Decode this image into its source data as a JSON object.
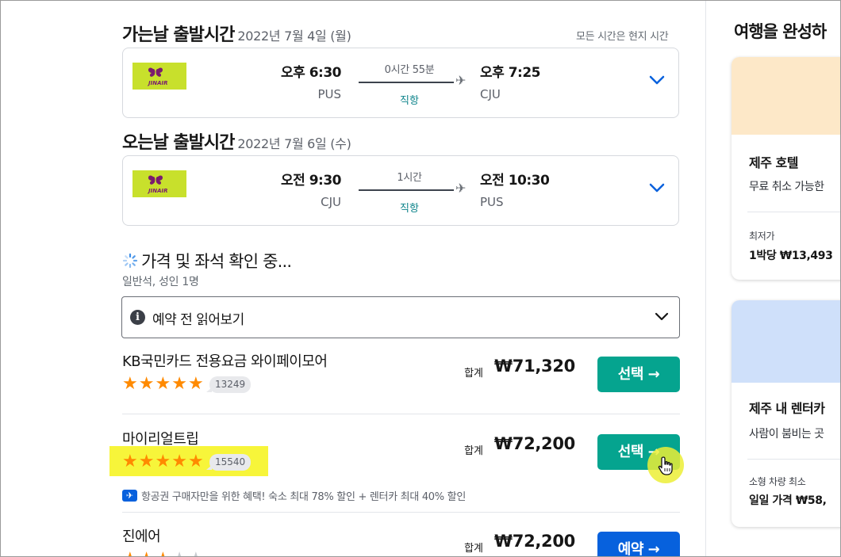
{
  "outbound": {
    "title": "가는날 출발시간",
    "date": "2022년 7월 4일 (월)",
    "timezone_note": "모든 시간은 현지 시간",
    "airline_logo_text": "JINAIR",
    "dep_time": "오후 6:30",
    "dep_code": "PUS",
    "duration": "0시간 55분",
    "stops": "직항",
    "arr_time": "오후 7:25",
    "arr_code": "CJU"
  },
  "inbound": {
    "title": "오는날 출발시간",
    "date": "2022년 7월 6일 (수)",
    "airline_logo_text": "JINAIR",
    "dep_time": "오전 9:30",
    "dep_code": "CJU",
    "duration": "1시간",
    "stops": "직항",
    "arr_time": "오전 10:30",
    "arr_code": "PUS"
  },
  "loading": {
    "text": "가격 및 좌석 확인 중...",
    "cabin": "일반석, 성인 1명"
  },
  "notice": {
    "label": "예약 전 읽어보기"
  },
  "providers": [
    {
      "name": "KB국민카드 전용요금 와이페이모어",
      "rating_stars": 5,
      "reviews": "13249",
      "price_label": "합계",
      "price": "₩71,320",
      "button": "선택 →",
      "button_color": "#05a48f"
    },
    {
      "name": "마이리얼트립",
      "rating_stars": 5,
      "reviews": "15540",
      "price_label": "합계",
      "price": "₩72,200",
      "button": "선택 →",
      "button_color": "#05a48f",
      "perk": "항공권 구매자만을 위한 혜택! 숙소 최대 78% 할인 + 렌터카 최대 40% 할인"
    },
    {
      "name": "진에어",
      "rating_stars": 3,
      "price_label": "합계",
      "price": "₩72,200",
      "button": "예약 →",
      "button_color": "#0761dd"
    }
  ],
  "sidebar": {
    "title": "여행을 완성하",
    "cards": [
      {
        "name": "제주 호텔",
        "desc": "무료 취소 가능한",
        "label": "최저가",
        "price": "1박당 ₩13,493",
        "image_color": "#fde8c8"
      },
      {
        "name": "제주 내 렌터카",
        "desc": "사람이 붐비는 곳",
        "label": "소형 차량 최소",
        "price": "일일 가격 ₩58,",
        "image_color": "#cfe0fa"
      }
    ]
  },
  "colors": {
    "teal": "#05a48f",
    "blue": "#0761dd",
    "star": "#ff8a00",
    "logo_bg": "#c8e02c",
    "highlight": "#f7f53a"
  }
}
